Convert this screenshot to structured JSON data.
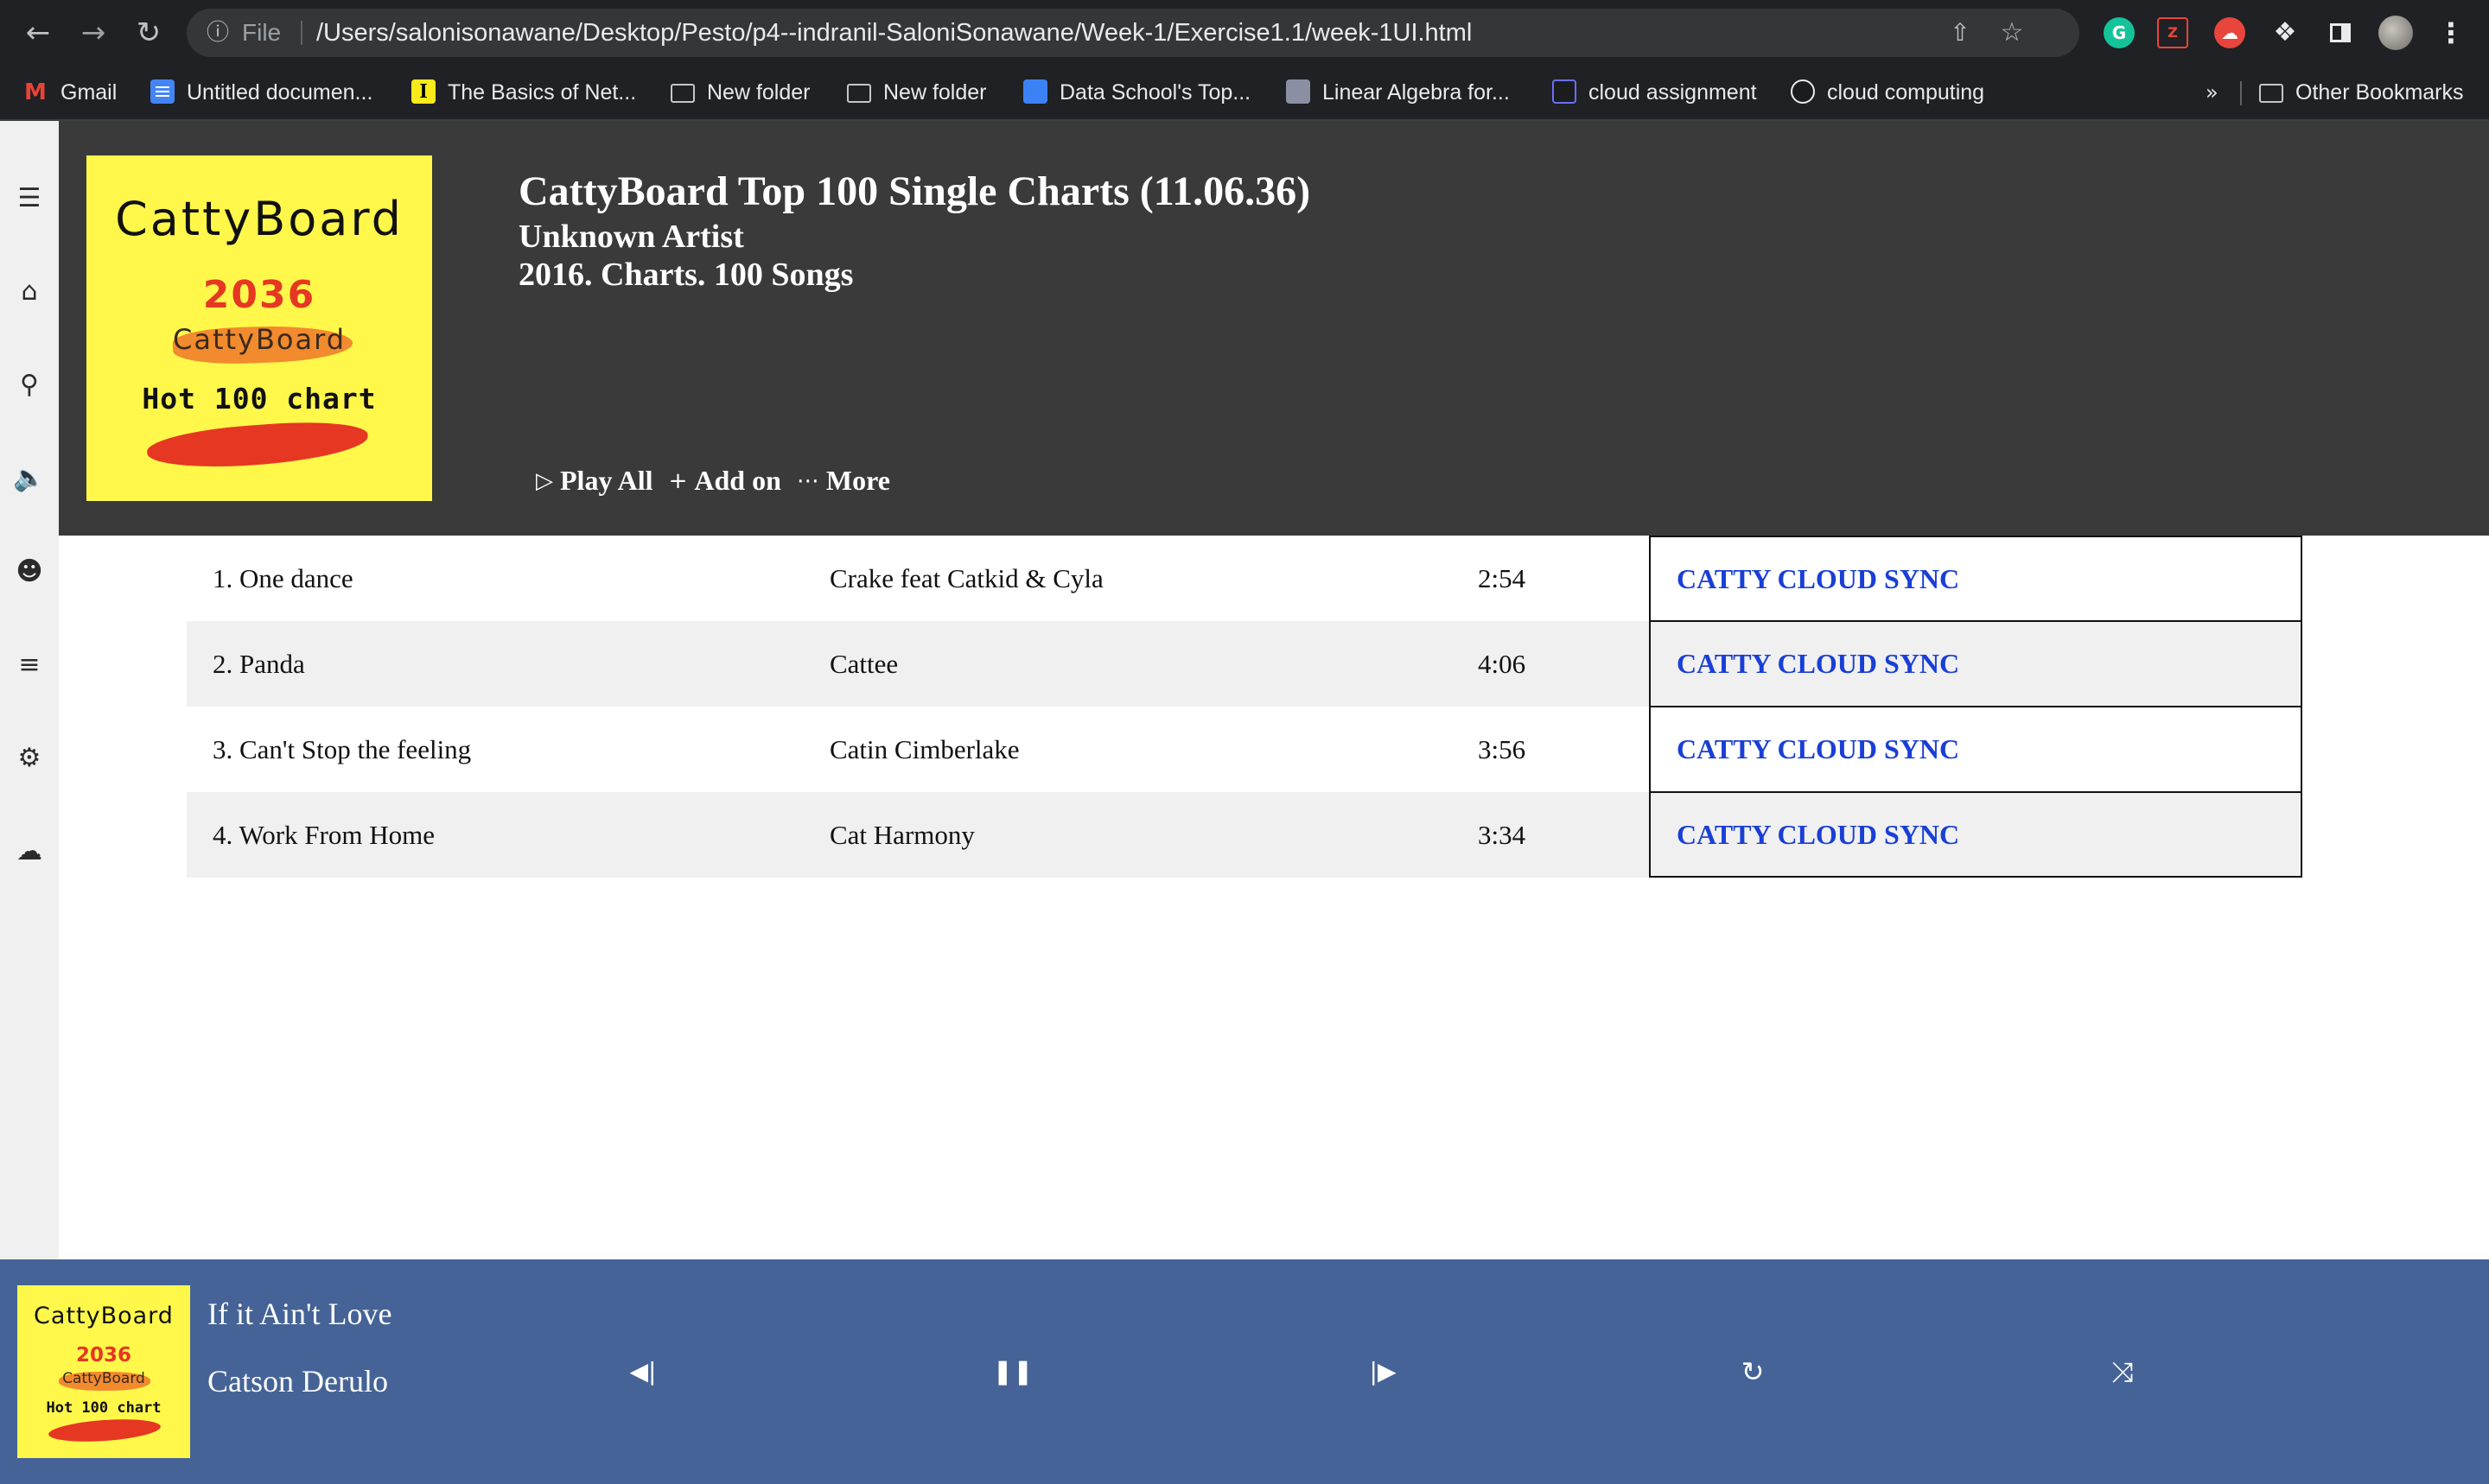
{
  "browser": {
    "scheme_label": "File",
    "url": "/Users/salonisonawane/Desktop/Pesto/p4--indranil-SaloniSonawane/Week-1/Exercise1.1/week-1UI.html",
    "bookmarks": [
      {
        "label": "Gmail",
        "icon": "gmail-icon"
      },
      {
        "label": "Untitled documen...",
        "icon": "docs-icon"
      },
      {
        "label": "The Basics of Net...",
        "icon": "site-icon"
      },
      {
        "label": "New folder",
        "icon": "folder-icon"
      },
      {
        "label": "New folder",
        "icon": "folder-icon"
      },
      {
        "label": "Data School's Top...",
        "icon": "site-icon"
      },
      {
        "label": "Linear Algebra for...",
        "icon": "site-icon"
      },
      {
        "label": "cloud assignment",
        "icon": "site-icon"
      },
      {
        "label": "cloud computing",
        "icon": "site-icon"
      }
    ],
    "bookmarks_more": "»",
    "other_bookmarks": "Other Bookmarks"
  },
  "sidebar": {
    "icons": [
      "menu-icon",
      "home-icon",
      "search-icon",
      "volume-icon",
      "user-icon",
      "spotify-icon",
      "settings-icon",
      "soundcloud-icon"
    ]
  },
  "album": {
    "cover": {
      "brand": "CattyBoard",
      "year": "2036",
      "brand_small": "CattyBoard",
      "subtitle": "Hot 100 chart",
      "colors": {
        "background": "#fff84a",
        "year": "#e63722",
        "stroke_orange": "#f28a2e",
        "stroke_red": "#e63722"
      }
    },
    "title": "CattyBoard Top 100 Single Charts (11.06.36)",
    "artist": "Unknown Artist",
    "meta": "2016. Charts. 100 Songs",
    "actions": {
      "play_all": "Play All",
      "add_on": "Add on",
      "more": "More"
    }
  },
  "tracks": [
    {
      "name": "1. One dance",
      "artist": "Crake feat Catkid & Cyla",
      "duration": "2:54",
      "sync": "CATTY CLOUD SYNC"
    },
    {
      "name": "2. Panda",
      "artist": "Cattee",
      "duration": "4:06",
      "sync": "CATTY CLOUD SYNC"
    },
    {
      "name": "3. Can't Stop the feeling",
      "artist": "Catin Cimberlake",
      "duration": "3:56",
      "sync": "CATTY CLOUD SYNC"
    },
    {
      "name": "4. Work From Home",
      "artist": "Cat Harmony",
      "duration": "3:34",
      "sync": "CATTY CLOUD SYNC"
    }
  ],
  "player": {
    "title": "If it Ain't Love",
    "artist": "Catson Derulo",
    "controls": [
      "previous-icon",
      "pause-icon",
      "next-icon",
      "repeat-icon",
      "shuffle-icon"
    ]
  },
  "colors": {
    "header_bg": "#3a3a3a",
    "player_bg": "#456396",
    "sync_link": "#1a3fd6",
    "row_alt": "#f0f0f0"
  }
}
